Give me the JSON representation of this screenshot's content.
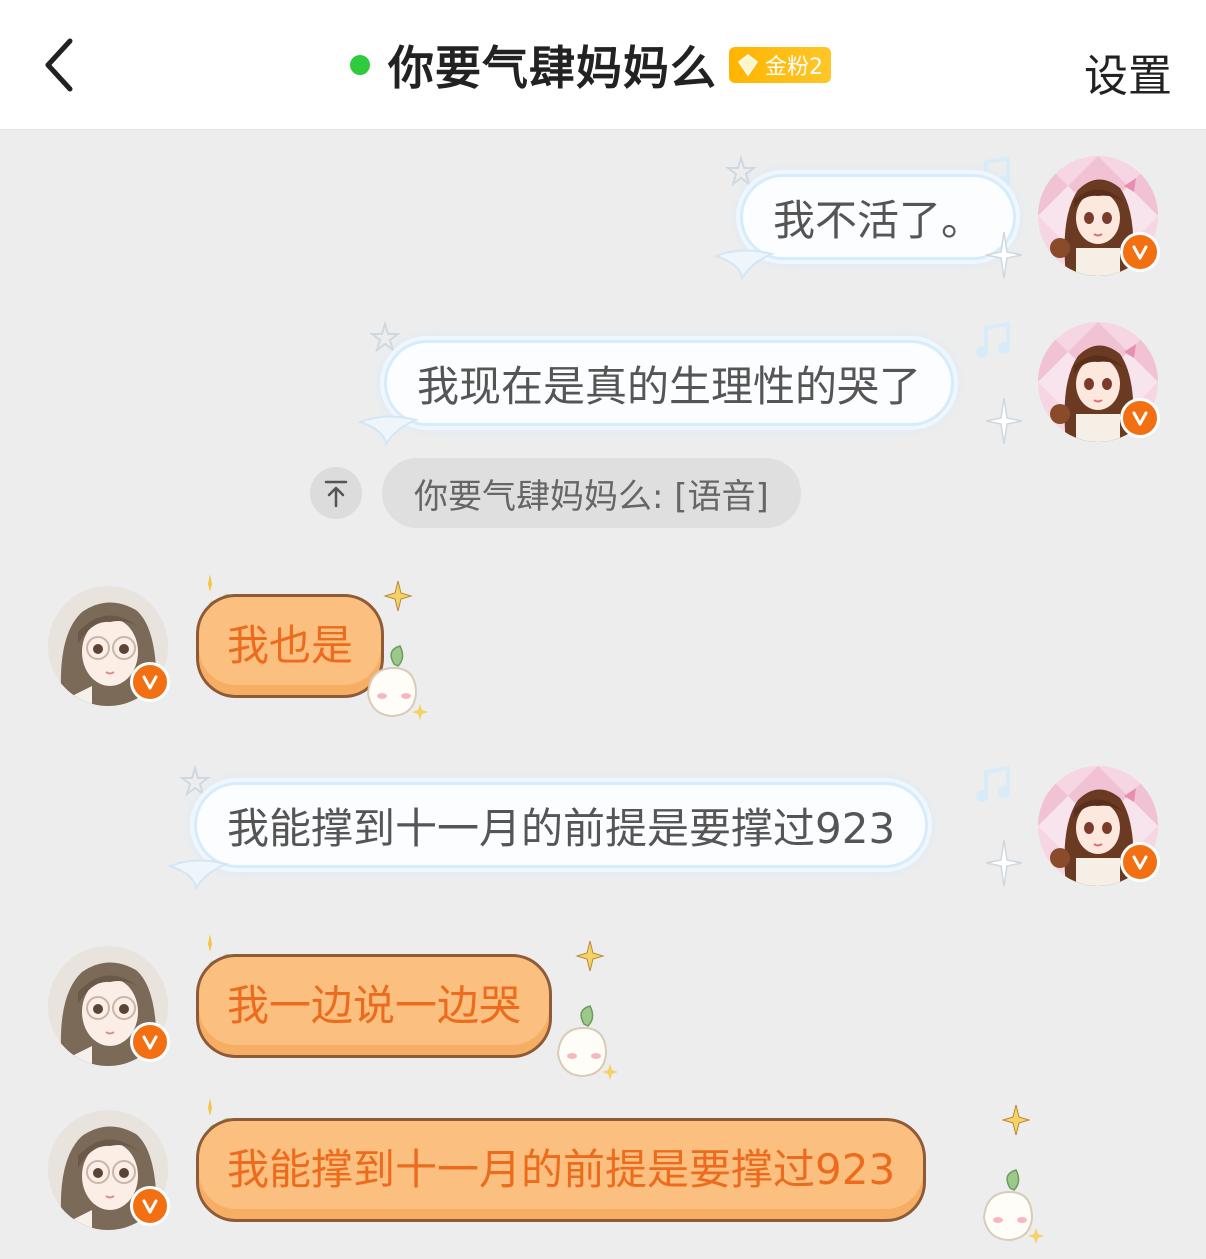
{
  "header": {
    "title": "你要气肆妈妈么",
    "fan_badge": "金粉2",
    "settings_label": "设置",
    "online_color": "#2fcb3c"
  },
  "messages": [
    {
      "side": "right",
      "style": "blue",
      "text": "我不活了。"
    },
    {
      "side": "right",
      "style": "blue",
      "text": "我现在是真的生理性的哭了"
    },
    {
      "type": "system",
      "text": "你要气肆妈妈么: [语音]"
    },
    {
      "side": "left",
      "style": "orange",
      "text": "我也是"
    },
    {
      "side": "right",
      "style": "blue",
      "text": "我能撑到十一月的前提是要撑过923"
    },
    {
      "side": "left",
      "style": "orange",
      "text": "我一边说一边哭"
    },
    {
      "side": "left",
      "style": "orange",
      "text": "我能撑到十一月的前提是要撑过923"
    }
  ],
  "colors": {
    "accent_orange": "#ec6b1c",
    "verified_badge": "#f26f12",
    "bubble_orange": "#fbc07f",
    "bubble_blue_border": "#d7ecfb"
  }
}
